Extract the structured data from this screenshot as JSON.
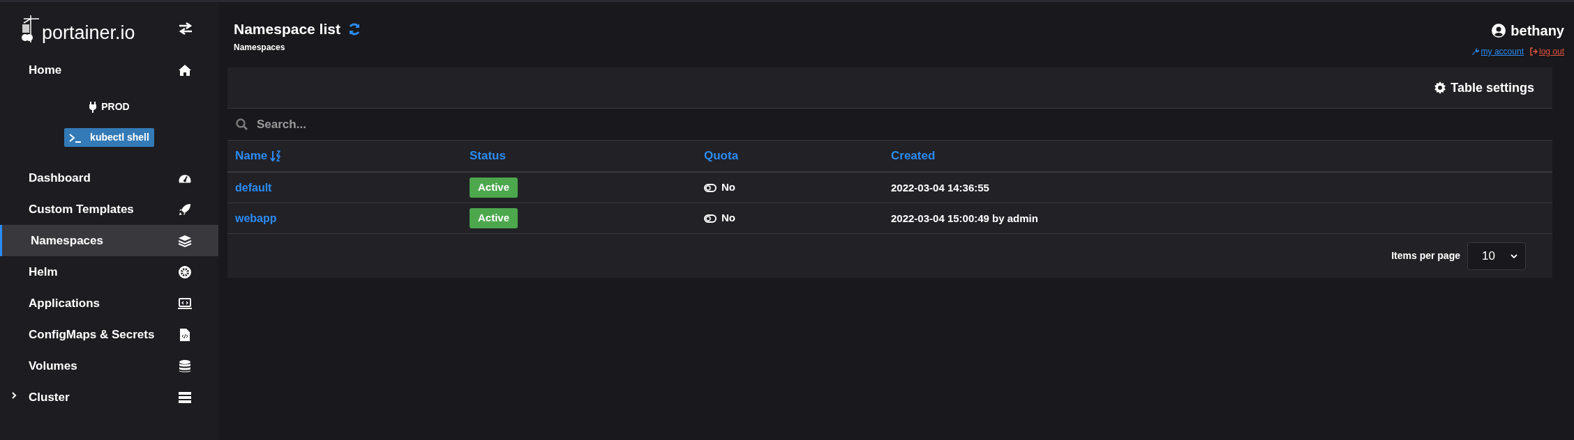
{
  "sidebar": {
    "logo": "portainer.io",
    "home": {
      "label": "Home",
      "selected": false
    },
    "environment": {
      "name": "PROD"
    },
    "shell_button": "kubectl shell",
    "items": [
      {
        "label": "Dashboard",
        "selected": false,
        "kind": "link"
      },
      {
        "label": "Custom Templates",
        "selected": false,
        "kind": "link"
      },
      {
        "label": "Namespaces",
        "selected": true,
        "kind": "link"
      },
      {
        "label": "Helm",
        "selected": false,
        "kind": "link"
      },
      {
        "label": "Applications",
        "selected": false,
        "kind": "link"
      },
      {
        "label": "ConfigMaps & Secrets",
        "selected": false,
        "kind": "link"
      },
      {
        "label": "Volumes",
        "selected": false,
        "kind": "link"
      },
      {
        "label": "Cluster",
        "selected": false,
        "kind": "group",
        "expanded": false
      }
    ]
  },
  "header": {
    "title": "Namespace list",
    "breadcrumb": "Namespaces",
    "user": "bethany",
    "my_account": "my account",
    "log_out": "log out"
  },
  "table": {
    "settings": "Table settings",
    "search": {
      "placeholder": "Search..."
    },
    "columns": [
      {
        "label": "Name",
        "sorted": true
      },
      {
        "label": "Status",
        "sorted": false
      },
      {
        "label": "Quota",
        "sorted": false
      },
      {
        "label": "Created",
        "sorted": false
      }
    ],
    "rows": [
      {
        "name": "default",
        "status": "Active",
        "quota": "No",
        "created": "2022-03-04 14:36:55"
      },
      {
        "name": "webapp",
        "status": "Active",
        "quota": "No",
        "created": "2022-03-04 15:00:49 by admin"
      }
    ],
    "footer": {
      "items_per_page": "Items per page",
      "page_size": "10"
    }
  }
}
